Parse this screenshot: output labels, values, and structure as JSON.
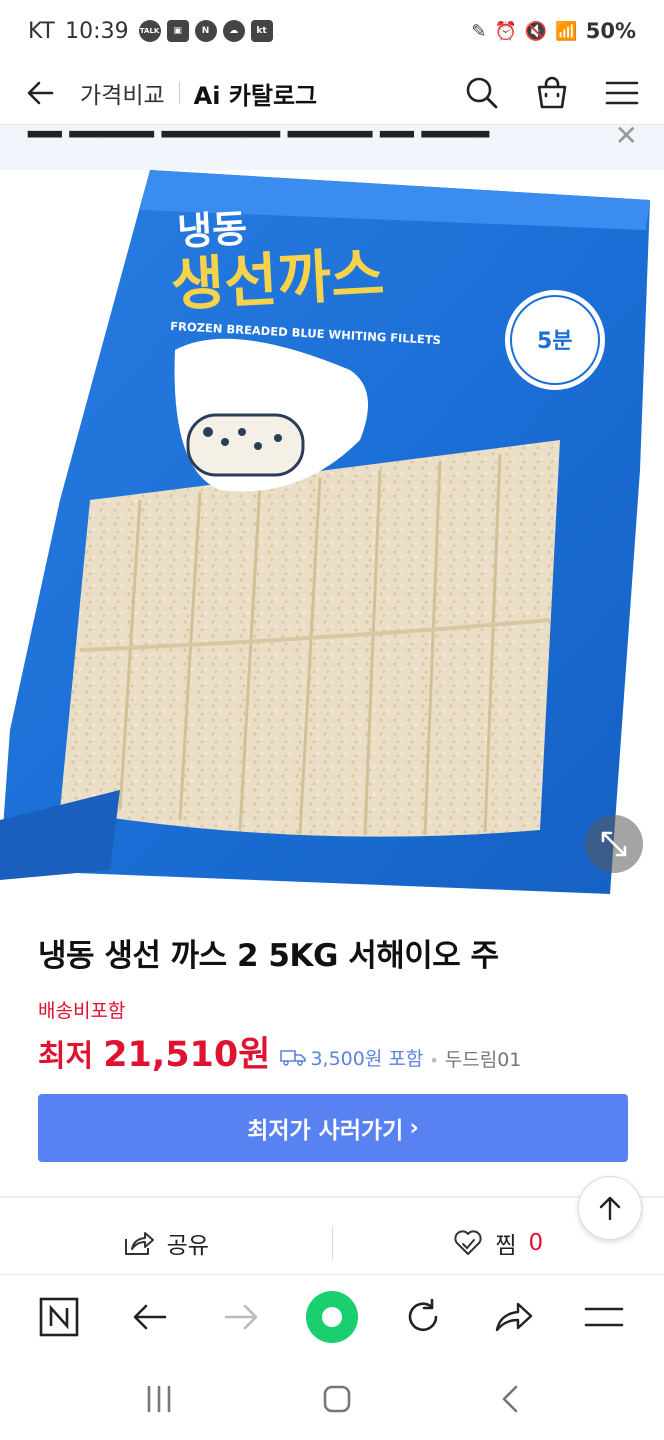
{
  "status_bar": {
    "carrier": "KT",
    "time": "10:39",
    "notifications": [
      "TALK",
      "gallery-icon",
      "N",
      "cloud-icon",
      "kt"
    ],
    "battery": "50%"
  },
  "header": {
    "crumb": "가격비교",
    "title": "Ai 카탈로그"
  },
  "product": {
    "title": "냉동 생선 까스 2 5KG 서해이오 주",
    "shipping_label": "배송비포함",
    "price_prefix": "최저",
    "price": "21,510원",
    "shipping_fee": "3,500원 포함",
    "seller": "두드림01",
    "image_text": {
      "line1": "냉동",
      "line2": "생선까스",
      "english": "FROZEN BREADED BLUE WHITING FILLETS",
      "badge": "5분"
    }
  },
  "buy_button": {
    "label": "최저가 사러가기"
  },
  "actions": {
    "share_label": "공유",
    "like_label": "찜",
    "like_count": "0"
  },
  "colors": {
    "accent_red": "#e0122f",
    "button_blue": "#5882f2",
    "link_blue": "#5b84e0",
    "naver_green": "#19cf6e"
  }
}
